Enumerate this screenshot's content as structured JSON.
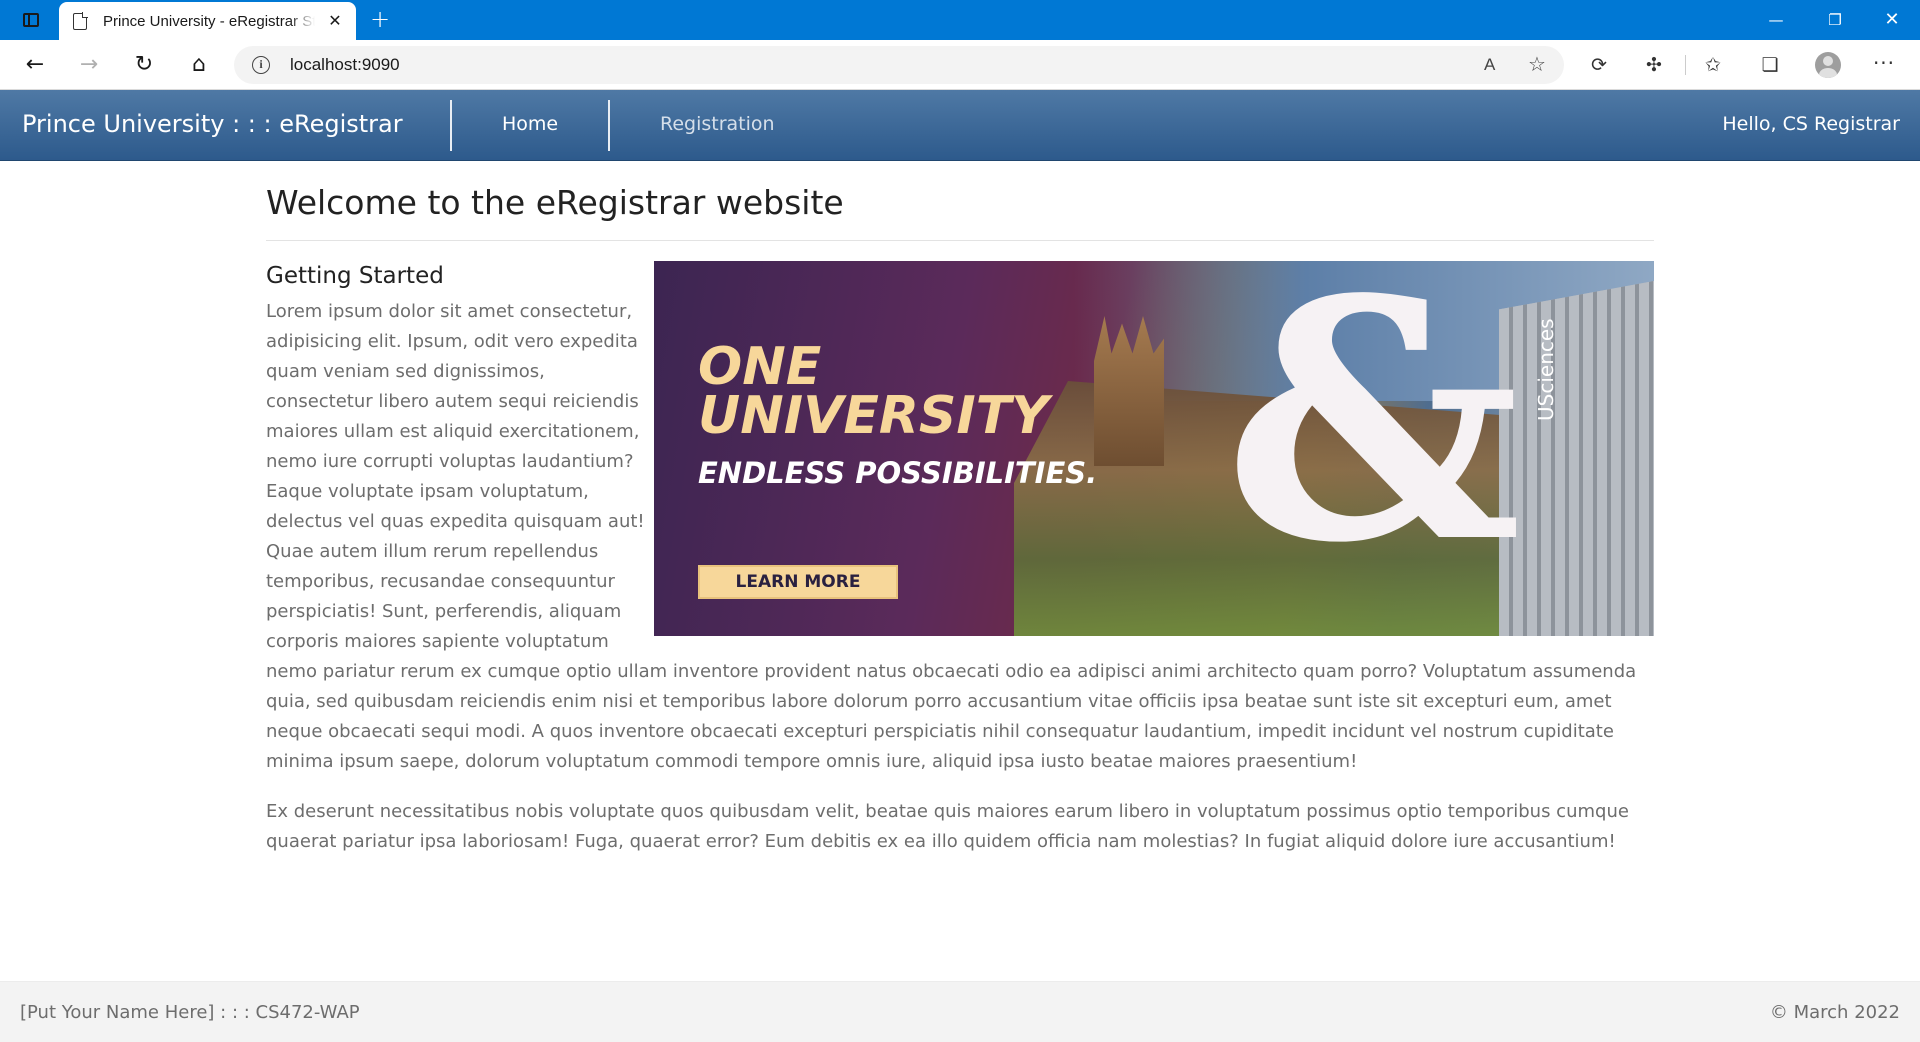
{
  "browser": {
    "tab_title": "Prince University - eRegistrar Student",
    "tab_close_glyph": "✕",
    "new_tab_glyph": "+",
    "url": "localhost:9090",
    "minimize_glyph": "—",
    "restore_glyph": "❐",
    "close_glyph": "✕",
    "back_glyph": "←",
    "forward_glyph": "→",
    "reload_glyph": "↻",
    "home_glyph": "⌂",
    "read_aloud_glyph": "A",
    "favorite_glyph": "☆",
    "more_glyph": "···",
    "icons": [
      "tab-actions-icon",
      "page-icon",
      "close-icon",
      "new-tab-icon",
      "minimize-icon",
      "restore-icon",
      "back-arrow-icon",
      "forward-arrow-icon",
      "reload-icon",
      "home-icon",
      "info-icon",
      "read-aloud-icon",
      "add-favorite-icon",
      "refresh-sync-icon",
      "extensions-icon",
      "favorites-icon",
      "collections-icon",
      "profile-icon",
      "more-icon"
    ]
  },
  "navbar": {
    "brand": "Prince University : : : eRegistrar",
    "links": [
      {
        "label": "Home",
        "active": true
      },
      {
        "label": "Registration",
        "active": false
      }
    ],
    "greeting": "Hello, CS Registrar",
    "background_colors": [
      "#4f79a5",
      "#2d5a8c"
    ]
  },
  "main": {
    "title": "Welcome to the eRegistrar website",
    "subheading": "Getting Started",
    "paragraph1": "Lorem ipsum dolor sit amet consectetur, adipisicing elit. Ipsum, odit vero expedita quam veniam sed dignissimos, consectetur libero autem sequi reiciendis maiores ullam est aliquid exercitationem, nemo iure corrupti voluptas laudantium? Eaque voluptate ipsam voluptatum, delectus vel quas expedita quisquam aut! Quae autem illum rerum repellendus temporibus, recusandae consequuntur perspiciatis! Sunt, perferendis, aliquam corporis maiores sapiente voluptatum nemo pariatur rerum ex cumque optio ullam inventore provident natus obcaecati odio ea adipisci animi architecto quam porro? Voluptatum assumenda quia, sed quibusdam reiciendis enim nisi et temporibus labore dolorum porro accusantium vitae officiis ipsa beatae sunt iste sit excepturi eum, amet neque obcaecati sequi modi. A quos inventore obcaecati excepturi perspiciatis nihil consequatur laudantium, impedit incidunt vel nostrum cupiditate minima ipsum saepe, dolorum voluptatum commodi tempore omnis iure, aliquid ipsa iusto beatae maiores praesentium!",
    "paragraph2": "Ex deserunt necessitatibus nobis voluptate quos quibusdam velit, beatae quis maiores earum libero in voluptatum possimus optio temporibus cumque quaerat pariatur ipsa laboriosam! Fuga, quaerat error? Eum debitis ex ea illo quidem officia nam molestias? In fugiat aliquid dolore iure accusantium!",
    "banner": {
      "line1": "ONE",
      "line2": "UNIVERSITY",
      "line3": "ENDLESS POSSIBILITIES.",
      "button": "LEARN MORE",
      "ampersand": "&",
      "building_sign": "USciences",
      "accent_color": "#f7d79a"
    }
  },
  "footer": {
    "left": "[Put Your Name Here] : : : CS472-WAP",
    "right": "© March 2022"
  }
}
